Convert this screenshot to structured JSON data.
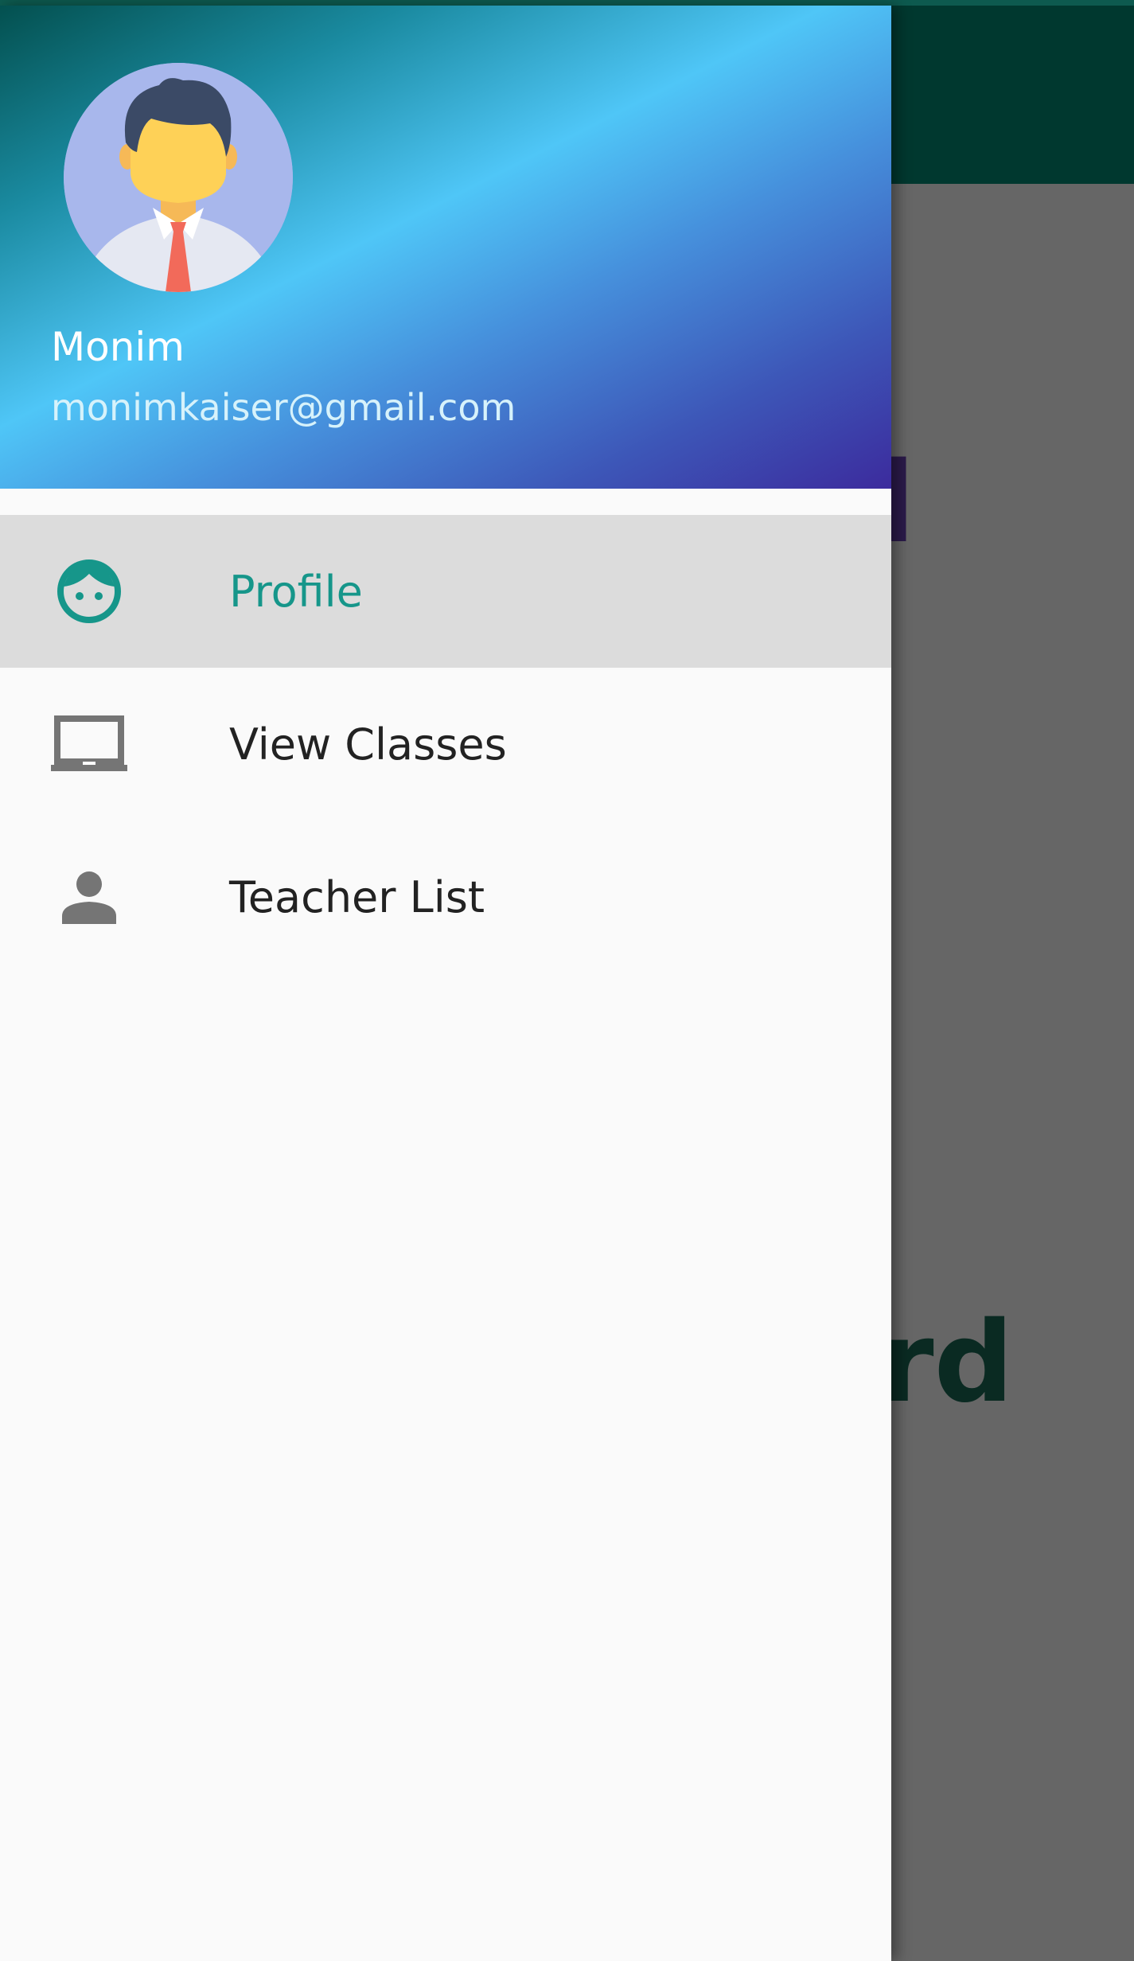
{
  "background_app": {
    "word_top": "d",
    "word_bottom": "ard"
  },
  "drawer": {
    "header": {
      "user_name": "Monim",
      "user_email": "monimkaiser@gmail.com",
      "avatar_icon": "user-avatar-icon"
    },
    "items": [
      {
        "label": "Profile",
        "icon": "face-icon",
        "selected": true
      },
      {
        "label": "View Classes",
        "icon": "laptop-icon",
        "selected": false
      },
      {
        "label": "Teacher List",
        "icon": "person-icon",
        "selected": false
      }
    ]
  },
  "colors": {
    "accent": "#16968a",
    "toolbar": "#00382f",
    "scrim": "#666666",
    "selected_bg": "#dcdcdc"
  }
}
